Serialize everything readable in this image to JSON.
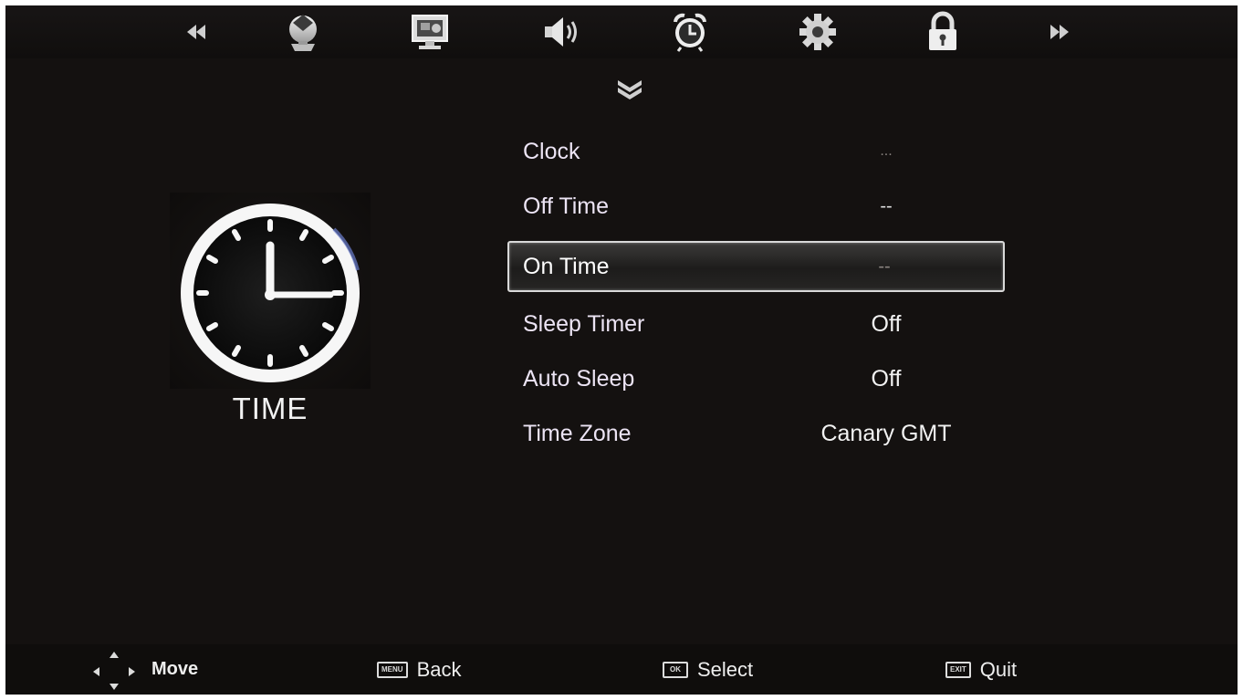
{
  "nav": {
    "icons": [
      "left-double-arrow-icon",
      "picture-icon",
      "screen-icon",
      "speaker-icon",
      "alarm-clock-icon",
      "gear-icon",
      "lock-icon",
      "right-double-arrow-icon"
    ],
    "active": "alarm-clock-icon"
  },
  "category": {
    "title": "TIME",
    "icon": "clock-icon"
  },
  "menu": {
    "selected_index": 2,
    "items": [
      {
        "label": "Clock",
        "value": "..."
      },
      {
        "label": "Off Time",
        "value": "--"
      },
      {
        "label": "On Time",
        "value": "--"
      },
      {
        "label": "Sleep Timer",
        "value": "Off"
      },
      {
        "label": "Auto Sleep",
        "value": "Off"
      },
      {
        "label": "Time Zone",
        "value": "Canary GMT"
      }
    ]
  },
  "footer": {
    "move_label": "Move",
    "back_key": "MENU",
    "back_label": "Back",
    "select_key": "OK",
    "select_label": "Select",
    "quit_key": "EXIT",
    "quit_label": "Quit"
  },
  "colors": {
    "background": "#141110",
    "text": "#f2f2f2",
    "highlight_border": "#d9d9d9"
  }
}
